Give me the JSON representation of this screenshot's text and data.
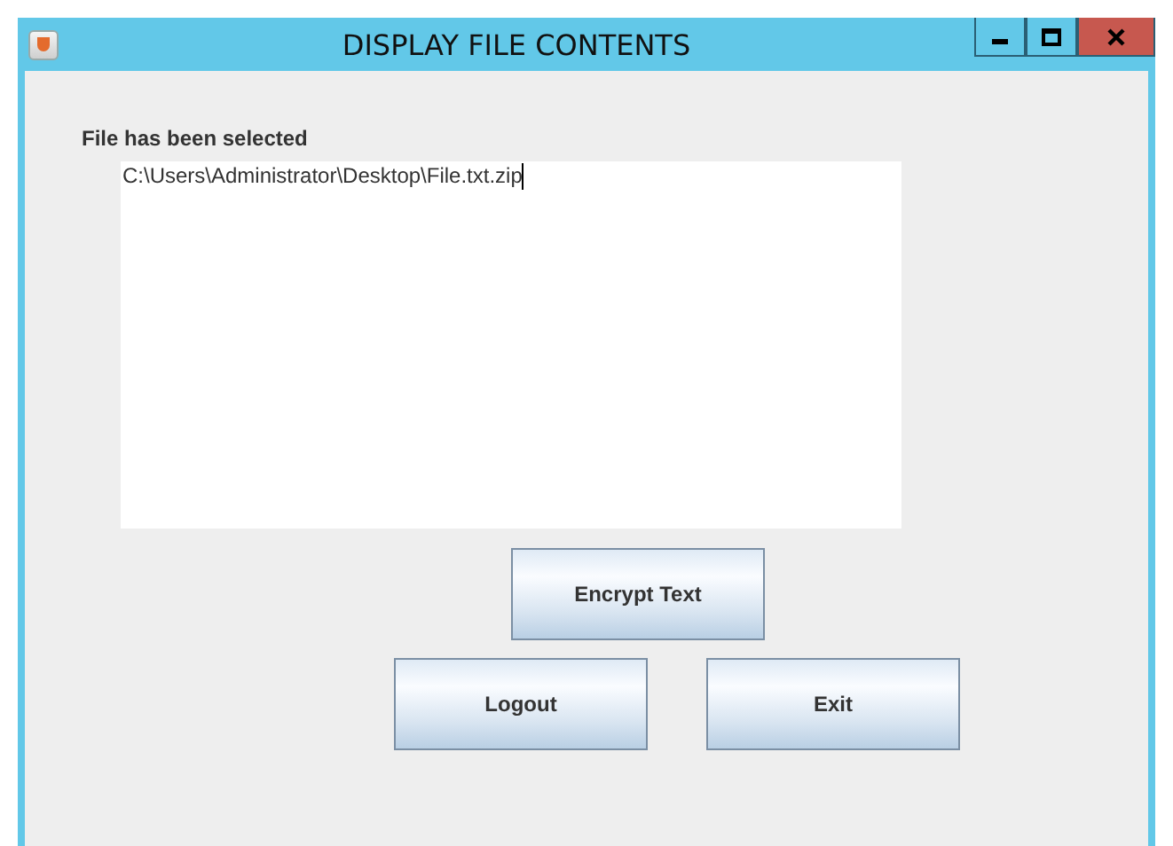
{
  "window": {
    "title": "DISPLAY FILE CONTENTS"
  },
  "label": "File has been selected",
  "text_area": {
    "value": "C:\\Users\\Administrator\\Desktop\\File.txt.zip"
  },
  "buttons": [
    {
      "label": "Encrypt Text"
    },
    {
      "label": "Logout"
    },
    {
      "label": "Exit"
    }
  ]
}
